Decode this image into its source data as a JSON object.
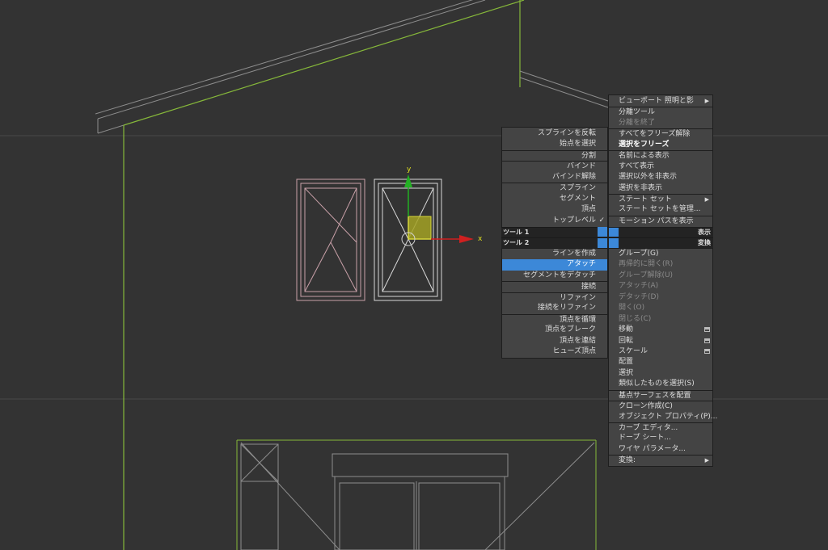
{
  "left_menu": {
    "items": [
      {
        "label": "スプラインを反転",
        "state": "normal"
      },
      {
        "label": "始点を選択",
        "state": "normal"
      },
      {
        "label": "分割",
        "state": "normal",
        "sep": true
      },
      {
        "label": "バインド",
        "state": "normal",
        "sep": true
      },
      {
        "label": "バインド解除",
        "state": "normal"
      },
      {
        "label": "スプライン",
        "state": "normal",
        "sep": true
      },
      {
        "label": "セグメント",
        "state": "normal"
      },
      {
        "label": "頂点",
        "state": "normal"
      },
      {
        "label": "トップレベル",
        "state": "normal",
        "checked": true
      }
    ]
  },
  "quad_headers": {
    "tools1": "ツール 1",
    "display": "表示",
    "tools2": "ツール 2",
    "transform": "変換"
  },
  "left_menu_lower": {
    "items": [
      {
        "label": "ラインを作成",
        "state": "normal"
      },
      {
        "label": "アタッチ",
        "state": "selected"
      },
      {
        "label": "セグメントをデタッチ",
        "state": "normal"
      },
      {
        "label": "接続",
        "state": "normal",
        "sep": true
      },
      {
        "label": "リファイン",
        "state": "normal",
        "sep": true
      },
      {
        "label": "接続をリファイン",
        "state": "normal"
      },
      {
        "label": "頂点を循環",
        "state": "normal",
        "sep": true
      },
      {
        "label": "頂点をブレーク",
        "state": "normal"
      },
      {
        "label": "頂点を連結",
        "state": "normal"
      },
      {
        "label": "ヒューズ頂点",
        "state": "normal"
      }
    ]
  },
  "right_menu_upper": {
    "items": [
      {
        "label": "ビューポート 照明と影",
        "state": "normal",
        "submenu": true
      },
      {
        "label": "分離ツール",
        "state": "normal",
        "sep": true
      },
      {
        "label": "分離を終了",
        "state": "disabled"
      },
      {
        "label": "すべてをフリーズ解除",
        "state": "normal",
        "sep": true
      },
      {
        "label": "選択をフリーズ",
        "state": "bold"
      },
      {
        "label": "名前による表示",
        "state": "normal",
        "sep": true
      },
      {
        "label": "すべて表示",
        "state": "normal"
      },
      {
        "label": "選択以外を非表示",
        "state": "normal"
      },
      {
        "label": "選択を非表示",
        "state": "normal"
      },
      {
        "label": "ステート セット",
        "state": "normal",
        "sep": true,
        "submenu": true
      },
      {
        "label": "ステート セットを管理...",
        "state": "normal"
      },
      {
        "label": "モーション パスを表示",
        "state": "normal",
        "sep": true
      }
    ]
  },
  "right_menu_lower": {
    "items": [
      {
        "label": "グループ(G)",
        "state": "normal"
      },
      {
        "label": "再帰的に開く(R)",
        "state": "disabled"
      },
      {
        "label": "グループ解除(U)",
        "state": "disabled"
      },
      {
        "label": "アタッチ(A)",
        "state": "disabled"
      },
      {
        "label": "デタッチ(D)",
        "state": "disabled"
      },
      {
        "label": "開く(O)",
        "state": "disabled"
      },
      {
        "label": "閉じる(C)",
        "state": "disabled"
      },
      {
        "label": "移動",
        "state": "normal",
        "options": true
      },
      {
        "label": "回転",
        "state": "normal",
        "options": true
      },
      {
        "label": "スケール",
        "state": "normal",
        "options": true
      },
      {
        "label": "配置",
        "state": "normal"
      },
      {
        "label": "選択",
        "state": "normal"
      },
      {
        "label": "類似したものを選択(S)",
        "state": "normal"
      },
      {
        "label": "基点サーフェスを配置",
        "state": "normal",
        "sep": true
      },
      {
        "label": "クローン作成(C)",
        "state": "normal",
        "sep": true
      },
      {
        "label": "オブジェクト プロパティ(P)...",
        "state": "normal"
      },
      {
        "label": "カーブ エディタ...",
        "state": "normal",
        "sep": true
      },
      {
        "label": "ドープ シート...",
        "state": "normal"
      },
      {
        "label": "ワイヤ パラメータ...",
        "state": "normal"
      },
      {
        "label": "変換:",
        "state": "normal",
        "sep": true,
        "submenu": true
      }
    ]
  },
  "gizmo": {
    "x_label": "x",
    "y_label": "y"
  },
  "colors": {
    "viewport_bg": "#333333",
    "menu_bg": "#444444",
    "highlight": "#3c88d8",
    "roof_green": "#8fbf3f",
    "gizmo_x": "#c81e1e",
    "gizmo_y": "#1ea41e",
    "gizmo_plane": "#b9b82a"
  }
}
